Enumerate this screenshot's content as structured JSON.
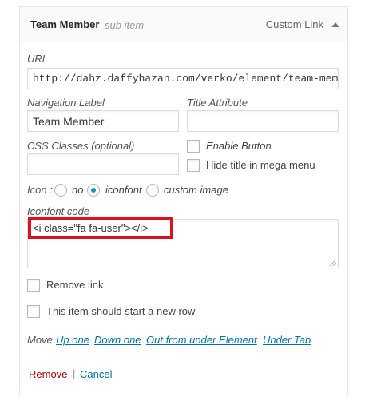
{
  "header": {
    "title": "Team Member",
    "subtitle": "sub item",
    "type": "Custom Link"
  },
  "url": {
    "label": "URL",
    "value": "http://dahz.daffyhazan.com/verko/element/team-mem"
  },
  "nav_label": {
    "label": "Navigation Label",
    "value": "Team Member"
  },
  "title_attr": {
    "label": "Title Attribute",
    "value": ""
  },
  "css_classes": {
    "label": "CSS Classes (optional)",
    "value": ""
  },
  "options": {
    "enable_button": "Enable Button",
    "hide_title": "Hide title in mega menu"
  },
  "icon": {
    "label": "Icon :",
    "choices": [
      "no",
      "iconfont",
      "custom image"
    ],
    "selected": "iconfont"
  },
  "iconfont": {
    "label": "Iconfont code",
    "value": "<i class=\"fa fa-user\"></i>"
  },
  "checkboxes": {
    "remove_link": "Remove link",
    "new_row": "This item should start a new row"
  },
  "move": {
    "label": "Move",
    "links": [
      "Up one",
      "Down one",
      "Out from under Element",
      "Under Tab"
    ]
  },
  "actions": {
    "remove": "Remove",
    "separator": "|",
    "cancel": "Cancel"
  }
}
